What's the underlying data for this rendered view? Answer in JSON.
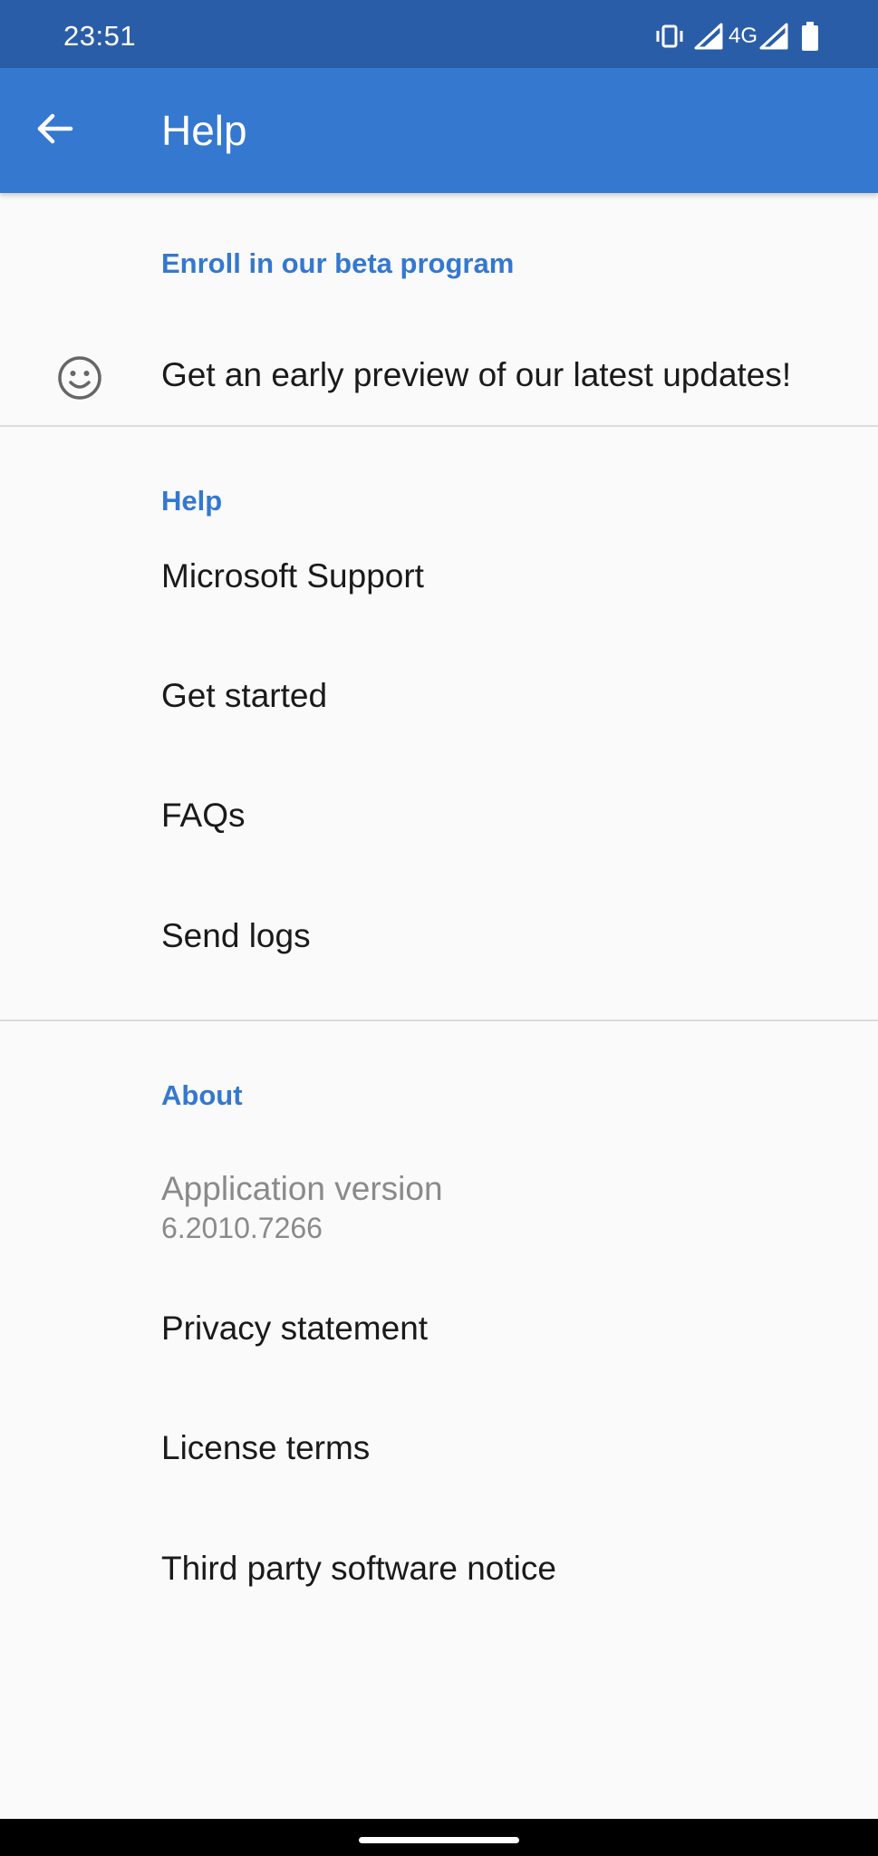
{
  "status_bar": {
    "time": "23:51",
    "network": "4G",
    "icons": [
      "vibrate-icon",
      "signal-icon",
      "signal-icon",
      "battery-icon"
    ]
  },
  "app_bar": {
    "title": "Help",
    "back_icon": "arrow-back-icon",
    "color": "#3478cf"
  },
  "beta": {
    "header": "Enroll in our beta program",
    "item_label": "Get an early preview of our latest updates!",
    "icon": "smiley-icon"
  },
  "help_section": {
    "header": "Help",
    "items": [
      {
        "label": "Microsoft Support"
      },
      {
        "label": "Get started"
      },
      {
        "label": "FAQs"
      },
      {
        "label": "Send logs"
      }
    ]
  },
  "about_section": {
    "header": "About",
    "version_label": "Application version",
    "version_value": "6.2010.7266",
    "items": [
      {
        "label": "Privacy statement"
      },
      {
        "label": "License terms"
      },
      {
        "label": "Third party software notice"
      }
    ]
  },
  "colors": {
    "status_bar": "#2a5da8",
    "accent": "#3478cf",
    "background": "#fafafa",
    "text": "#1a1a1a",
    "secondary_text": "#8a8a8a"
  }
}
